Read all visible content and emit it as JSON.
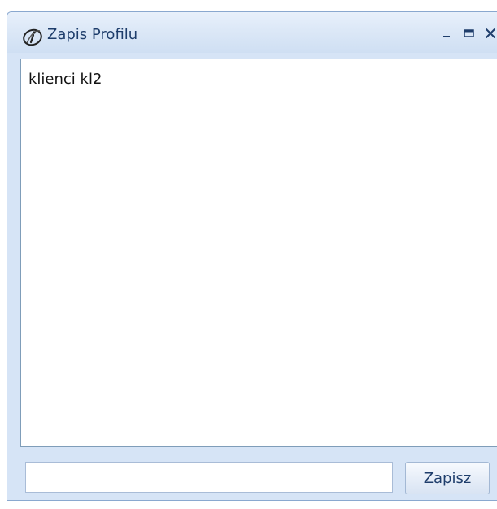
{
  "window": {
    "title": "Zapis Profilu",
    "icon": "app-logo-icon",
    "controls": {
      "minimize_icon": "minimize-icon",
      "maximize_icon": "maximize-icon",
      "close_icon": "close-icon"
    }
  },
  "content": {
    "text": "klienci kl2"
  },
  "footer": {
    "input_value": "",
    "save_label": "Zapisz"
  },
  "colors": {
    "frame": "#d6e4f6",
    "title_text": "#1e3d6b",
    "border": "#7f9db9"
  }
}
